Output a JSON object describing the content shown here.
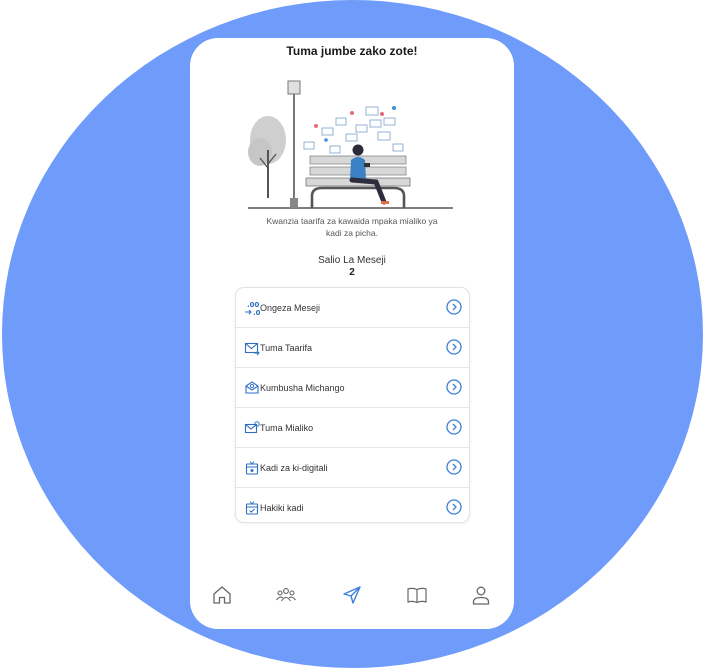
{
  "screen": {
    "title": "Tuma jumbe zako zote!",
    "description": "Kwanzia taarifa za kawaida mpaka mialiko ya kadi za picha.",
    "balance_label": "Salio La Meseji",
    "balance_value": "2"
  },
  "menu": {
    "items": [
      {
        "label": "Ongeza Meseji",
        "icon": "add-messages-icon"
      },
      {
        "label": "Tuma Taarifa",
        "icon": "send-mail-icon"
      },
      {
        "label": "Kumbusha Michango",
        "icon": "reminder-mail-icon"
      },
      {
        "label": "Tuma Mialiko",
        "icon": "invite-mail-icon"
      },
      {
        "label": "Kadi za ki-digitali",
        "icon": "digital-card-icon"
      },
      {
        "label": "Hakiki kadi",
        "icon": "verify-card-icon"
      }
    ],
    "chevron_icon": "chevron-right-circle-icon"
  },
  "bottom_nav": [
    {
      "name": "home",
      "icon": "home-icon"
    },
    {
      "name": "groups",
      "icon": "group-icon"
    },
    {
      "name": "send",
      "icon": "send-icon",
      "active": true
    },
    {
      "name": "book",
      "icon": "book-icon"
    },
    {
      "name": "profile",
      "icon": "user-icon"
    }
  ],
  "colors": {
    "background_circle": "#6f9bfb",
    "accent": "#3d7fd9",
    "text": "#333333"
  }
}
